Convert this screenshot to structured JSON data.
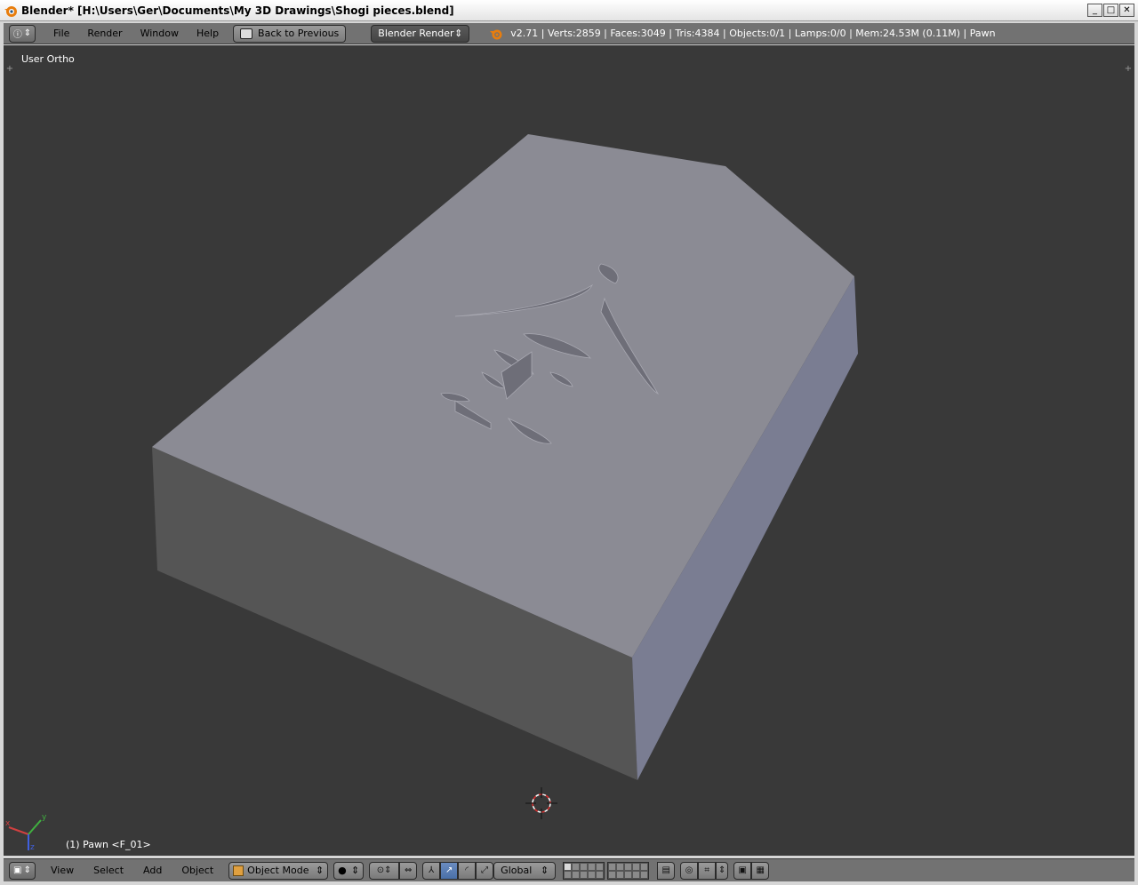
{
  "window": {
    "title": "Blender* [H:\\Users\\Ger\\Documents\\My 3D Drawings\\Shogi pieces.blend]",
    "min_glyph": "_",
    "max_glyph": "□",
    "close_glyph": "✕"
  },
  "infobar": {
    "menus": [
      "File",
      "Render",
      "Window",
      "Help"
    ],
    "back_button": "Back to Previous",
    "render_engine": "Blender Render",
    "stats": "v2.71 | Verts:2859 | Faces:3049 | Tris:4384 | Objects:0/1 | Lamps:0/0 | Mem:24.53M (0.11M) | Pawn"
  },
  "viewport": {
    "view_label": "User Ortho",
    "object_label": "(1) Pawn <F_01>",
    "axis_labels": {
      "x": "x",
      "y": "y",
      "z": "z"
    },
    "plus_glyph": "+"
  },
  "bottombar": {
    "menus": [
      "View",
      "Select",
      "Add",
      "Object"
    ],
    "mode": "Object Mode",
    "orientation": "Global"
  },
  "colors": {
    "viewport_bg": "#393939",
    "mesh_top": "#8b8b94",
    "mesh_front": "#555555",
    "mesh_side": "#7a7d92",
    "header": "#727272"
  }
}
